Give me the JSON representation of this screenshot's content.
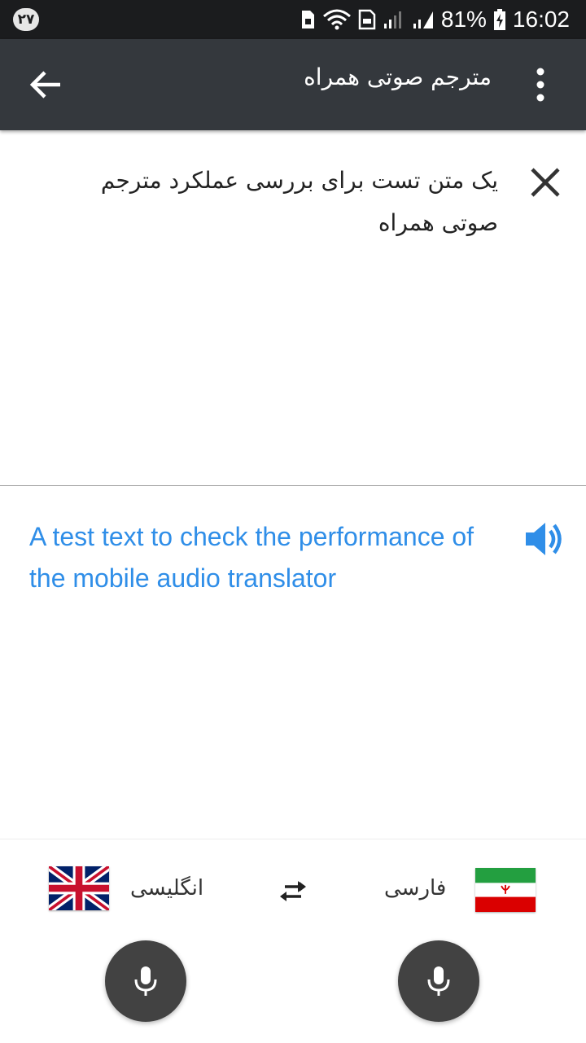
{
  "status_bar": {
    "badge": "۲۷",
    "battery": "81%",
    "time": "16:02",
    "icons": [
      "sim-icon",
      "wifi-icon",
      "sd-card-icon",
      "signal-icon",
      "signal-icon",
      "battery-charging-icon"
    ]
  },
  "app_bar": {
    "title": "مترجم صوتی همراه",
    "back_icon": "arrow-back-icon",
    "menu_icon": "more-vert-icon"
  },
  "source": {
    "text": "یک متن تست برای بررسی عملکرد مترجم صوتی همراه",
    "clear_icon": "close-icon"
  },
  "target": {
    "text": "A test text to check the performance of the mobile audio translator",
    "speak_icon": "speaker-icon"
  },
  "languages": {
    "left": {
      "label": "انگلیسی",
      "flag": "uk-flag-icon"
    },
    "right": {
      "label": "فارسی",
      "flag": "iran-flag-icon"
    },
    "swap_icon": "swap-icon"
  },
  "colors": {
    "status_bar": "#1b1c1e",
    "app_bar": "#34383d",
    "accent": "#2f8ee8",
    "mic_button": "#424242"
  }
}
